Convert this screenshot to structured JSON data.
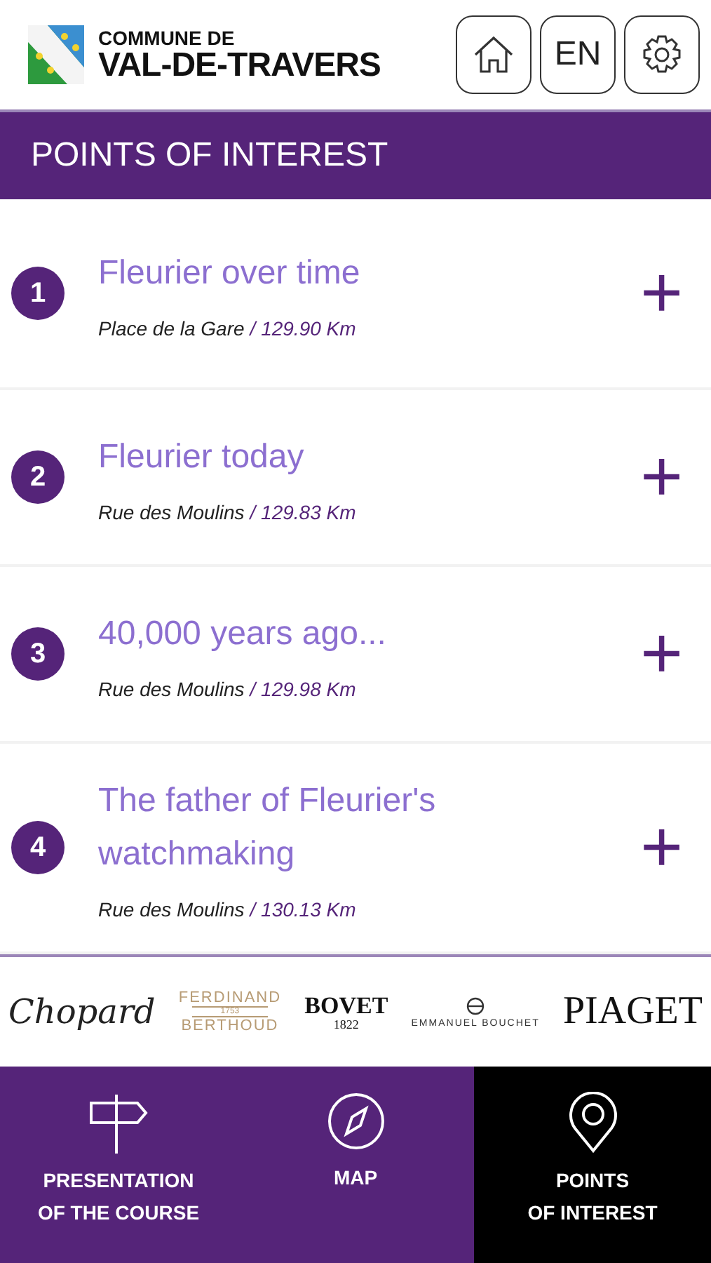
{
  "header": {
    "brand_small": "COMMUNE DE",
    "brand_large": "VAL-DE-TRAVERS",
    "buttons": [
      {
        "kind": "home"
      },
      {
        "kind": "text",
        "label": "EN"
      },
      {
        "kind": "settings"
      }
    ]
  },
  "title_bar": {
    "title": "POINTS OF INTEREST"
  },
  "points": [
    {
      "number": "1",
      "title": "Fleurier over time",
      "place": "Place de la Gare",
      "distance": "/ 129.90 Km",
      "action": "+"
    },
    {
      "number": "2",
      "title": "Fleurier today",
      "place": "Rue des Moulins",
      "distance": "/ 129.83 Km",
      "action": "+"
    },
    {
      "number": "3",
      "title": "40,000 years ago...",
      "place": "Rue des Moulins",
      "distance": "/ 129.98 Km",
      "action": "+"
    },
    {
      "number": "4",
      "title": "The father of Fleurier's watchmaking",
      "place": "Rue des Moulins",
      "distance": "/ 130.13 Km",
      "action": "+"
    }
  ],
  "sponsors": [
    {
      "kind": "script",
      "lines": [
        "Chopard"
      ]
    },
    {
      "kind": "ferdinand",
      "lines": [
        "FERDINAND",
        "1753",
        "BERTHOUD"
      ]
    },
    {
      "kind": "bovet",
      "lines": [
        "BOVET",
        "1822"
      ]
    },
    {
      "kind": "bouchet",
      "lines": [
        "EMMANUEL BOUCHET"
      ]
    },
    {
      "kind": "piaget",
      "lines": [
        "PIAGET"
      ]
    }
  ],
  "nav": [
    {
      "kind": "signpost",
      "lines": [
        "PRESENTATION",
        "OF THE COURSE"
      ],
      "selected": false
    },
    {
      "kind": "compass",
      "lines": [
        "MAP"
      ],
      "selected": false
    },
    {
      "kind": "pin",
      "lines": [
        "POINTS",
        "OF INTEREST"
      ],
      "selected": true
    }
  ]
}
